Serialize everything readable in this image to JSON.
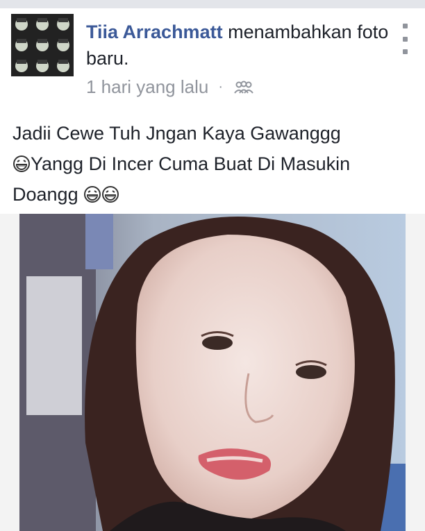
{
  "post": {
    "author": "Tiia Arrachmatt",
    "action": " menambahkan foto baru.",
    "time": "1 hari yang lalu",
    "separator": "·",
    "privacy_icon": "friends-icon",
    "text_line1": "Jadii Cewe Tuh Jngan Kaya Gawanggg",
    "text_line2": "Yangg Di Incer Cuma Buat Di Masukin",
    "text_line3": "Doangg",
    "emoji_name": "laughing-emoji",
    "photo_alt": "selfie-photo"
  },
  "colors": {
    "author": "#3b5998",
    "meta": "#90949c",
    "text": "#1d2129"
  }
}
